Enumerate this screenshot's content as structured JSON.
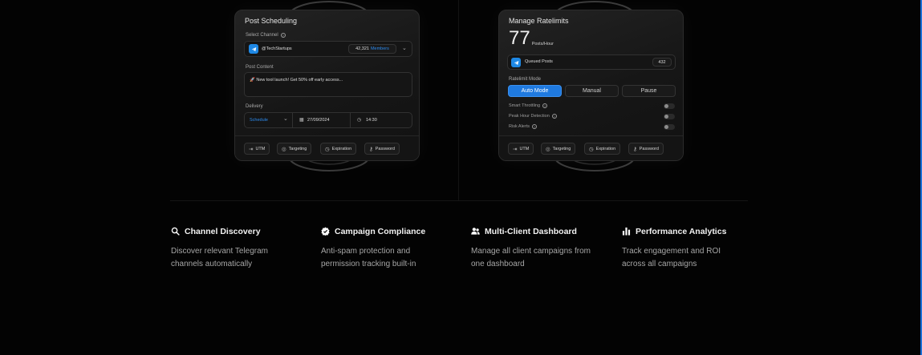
{
  "scheduling_card": {
    "title": "Post Scheduling",
    "select_channel_label": "Select Channel",
    "channel_name": "@TechStartups",
    "member_count": "42,321",
    "members_word": "Members",
    "post_content_label": "Post Content",
    "post_content_value": "🚀 New tool launch! Get 50% off early access...",
    "delivery_label": "Delivery",
    "delivery_mode": "Schedule",
    "delivery_date": "27/09/2024",
    "delivery_time": "14:30",
    "chips": [
      "UTM",
      "Targeting",
      "Expiration",
      "Password"
    ]
  },
  "ratelimit_card": {
    "title": "Manage Ratelimits",
    "rate_value": "77",
    "rate_unit": "Posts/Hour",
    "queued_label": "Queued Posts",
    "queued_count": "432",
    "mode_label": "Ratelimit Mode",
    "modes": [
      "Auto Mode",
      "Manual",
      "Pause"
    ],
    "active_mode": "Auto Mode",
    "toggles": [
      "Smart Throttling",
      "Peak Hour Detection",
      "Risk Alerts"
    ],
    "chips": [
      "UTM",
      "Targeting",
      "Expiration",
      "Password"
    ]
  },
  "features": [
    {
      "icon": "search-icon",
      "title": "Channel Discovery",
      "desc": "Discover relevant Telegram channels automatically"
    },
    {
      "icon": "verified-badge-icon",
      "title": "Campaign Compliance",
      "desc": "Anti-spam protection and permission tracking built-in"
    },
    {
      "icon": "users-icon",
      "title": "Multi-Client Dashboard",
      "desc": "Manage all client campaigns from one dashboard"
    },
    {
      "icon": "bar-chart-icon",
      "title": "Performance Analytics",
      "desc": "Track engagement and ROI across all campaigns"
    }
  ],
  "colors": {
    "accent": "#1f7ae0",
    "telegram": "#1e88e5",
    "background": "#030303"
  }
}
